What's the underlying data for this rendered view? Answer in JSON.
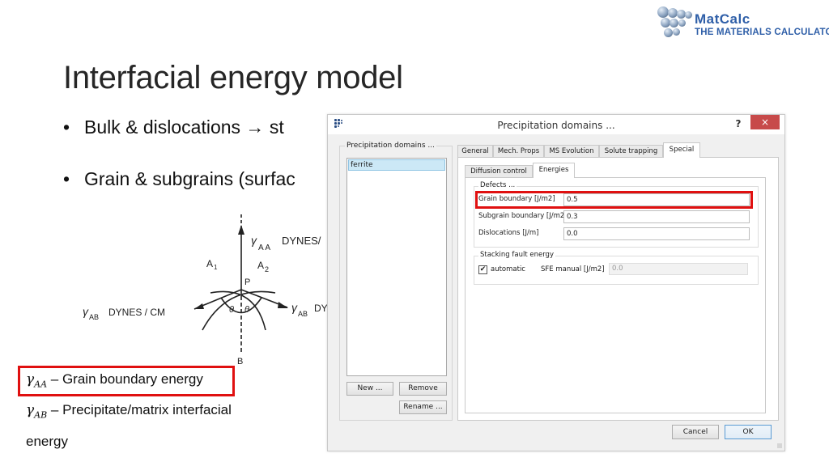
{
  "logo": {
    "line1": "MatCalc",
    "line2": "The Materials Calculator",
    "brand_color": "#2f5fa8"
  },
  "slide": {
    "title": "Interfacial energy model",
    "bullets": [
      {
        "dot": "•",
        "text": "Bulk & dislocations  → st"
      },
      {
        "dot": "•",
        "text": "Grain & subgrains (surfac"
      }
    ]
  },
  "diagram": {
    "labels": {
      "gamma_aa": "γ",
      "gamma_aa_sub": "A A",
      "dynes_top": "DYNES/",
      "a1": "A",
      "a1_sub": "1",
      "a2": "A",
      "a2_sub": "2",
      "p": "P",
      "theta": "θ",
      "gamma_ab": "γ",
      "gamma_ab_sub": "AB",
      "dynes_left": "DYNES / CM",
      "dynes_right": "DY",
      "b": "B"
    }
  },
  "legend": {
    "items": [
      {
        "symbol": "γ",
        "sub": "AA",
        "text": " – Grain boundary energy",
        "highlighted": true
      },
      {
        "symbol": "γ",
        "sub": "AB",
        "text": " – Precipitate/matrix interfacial"
      },
      {
        "text": "energy"
      }
    ],
    "highlight_color": "#e01010"
  },
  "dialog": {
    "title": "Precipitation domains ...",
    "help_label": "?",
    "close_label": "×",
    "domains_group_label": "Precipitation domains ...",
    "domains": [
      "ferrite"
    ],
    "selected_domain": "ferrite",
    "buttons": {
      "new": "New ...",
      "remove": "Remove",
      "rename": "Rename ...",
      "cancel": "Cancel",
      "ok": "OK"
    },
    "tabs": [
      {
        "label": "General",
        "active": false
      },
      {
        "label": "Mech. Props",
        "active": false
      },
      {
        "label": "MS Evolution",
        "active": false
      },
      {
        "label": "Solute trapping",
        "active": false
      },
      {
        "label": "Special",
        "active": true
      }
    ],
    "subtabs": [
      {
        "label": "Diffusion control",
        "active": false
      },
      {
        "label": "Energies",
        "active": true
      }
    ],
    "defects": {
      "group_label": "Defects ...",
      "fields": [
        {
          "label": "Grain boundary [J/m2]",
          "value": "0.5",
          "highlighted": true
        },
        {
          "label": "Subgrain boundary [J/m2]",
          "value": "0.3"
        },
        {
          "label": "Dislocations [J/m]",
          "value": "0.0"
        }
      ]
    },
    "stacking_fault": {
      "group_label": "Stacking fault energy",
      "automatic_label": "automatic",
      "automatic_checked": true,
      "check_glyph": "✔",
      "manual_label": "SFE  manual [J/m2]",
      "manual_value": "0.0",
      "manual_disabled": true
    },
    "close_color": "#c74a4a"
  }
}
